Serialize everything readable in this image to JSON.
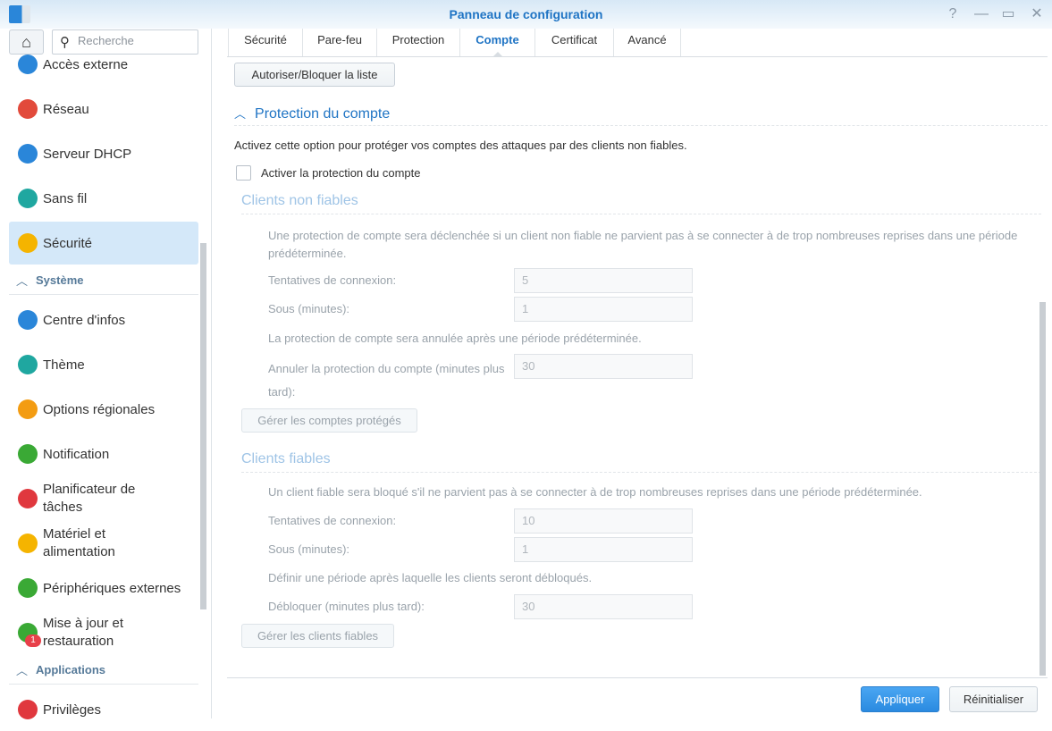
{
  "window": {
    "title": "Panneau de configuration",
    "help": "?",
    "minimize": "—",
    "maximize": "▭",
    "close": "✕"
  },
  "sidebar": {
    "search_placeholder": "Recherche",
    "items": [
      {
        "label": "Accès externe",
        "icon": "globe-icon",
        "color": "#2a86d9"
      },
      {
        "label": "Réseau",
        "icon": "house-network-icon",
        "color": "#e24a3b"
      },
      {
        "label": "Serveur DHCP",
        "icon": "dhcp-icon",
        "color": "#2a86d9"
      },
      {
        "label": "Sans fil",
        "icon": "wifi-icon",
        "color": "#1fa7a0"
      },
      {
        "label": "Sécurité",
        "icon": "shield-icon",
        "color": "#f5b400"
      }
    ],
    "section_system": "Système",
    "system_items": [
      {
        "label": "Centre d'infos",
        "icon": "info-icon",
        "color": "#2a86d9"
      },
      {
        "label": "Thème",
        "icon": "palette-icon",
        "color": "#1fa7a0"
      },
      {
        "label": "Options régionales",
        "icon": "map-clock-icon",
        "color": "#f39c12"
      },
      {
        "label": "Notification",
        "icon": "chat-bubble-icon",
        "color": "#3aa935"
      },
      {
        "label": "Planificateur de tâches",
        "icon": "calendar-check-icon",
        "color": "#e0383e"
      },
      {
        "label": "Matériel et alimentation",
        "icon": "lightbulb-icon",
        "color": "#f5b400"
      },
      {
        "label": "Périphériques externes",
        "icon": "upload-device-icon",
        "color": "#3aa935"
      },
      {
        "label": "Mise à jour et restauration",
        "icon": "update-icon",
        "color": "#3aa935",
        "badge": "1"
      }
    ],
    "section_apps": "Applications",
    "app_items": [
      {
        "label": "Privilèges",
        "icon": "privileges-icon",
        "color": "#e0383e"
      }
    ]
  },
  "tabs": [
    "Sécurité",
    "Pare-feu",
    "Protection",
    "Compte",
    "Certificat",
    "Avancé"
  ],
  "active_tab": "Compte",
  "main": {
    "allow_block_button": "Autoriser/Bloquer la liste",
    "section_title": "Protection du compte",
    "description": "Activez cette option pour protéger vos comptes des attaques par des clients non fiables.",
    "enable_checkbox": "Activer la protection du compte",
    "enable_checked": false,
    "untrusted": {
      "title": "Clients non fiables",
      "desc": "Une protection de compte sera déclenchée si un client non fiable ne parvient pas à se connecter à de trop nombreuses reprises dans une période prédéterminée.",
      "attempts_label": "Tentatives de connexion:",
      "attempts": "5",
      "within_label": "Sous (minutes):",
      "within": "1",
      "cancel_desc": "La protection de compte sera annulée après une période prédéterminée.",
      "cancel_label": "Annuler la protection du compte (minutes plus tard):",
      "cancel": "30",
      "manage_button": "Gérer les comptes protégés"
    },
    "trusted": {
      "title": "Clients fiables",
      "desc": "Un client fiable sera bloqué s'il ne parvient pas à se connecter à de trop nombreuses reprises dans une période prédéterminée.",
      "attempts_label": "Tentatives de connexion:",
      "attempts": "10",
      "within_label": "Sous (minutes):",
      "within": "1",
      "unblock_desc": "Définir une période après laquelle les clients seront débloqués.",
      "unblock_label": "Débloquer (minutes plus tard):",
      "unblock": "30",
      "manage_button": "Gérer les clients fiables"
    }
  },
  "footer": {
    "apply": "Appliquer",
    "reset": "Réinitialiser"
  }
}
